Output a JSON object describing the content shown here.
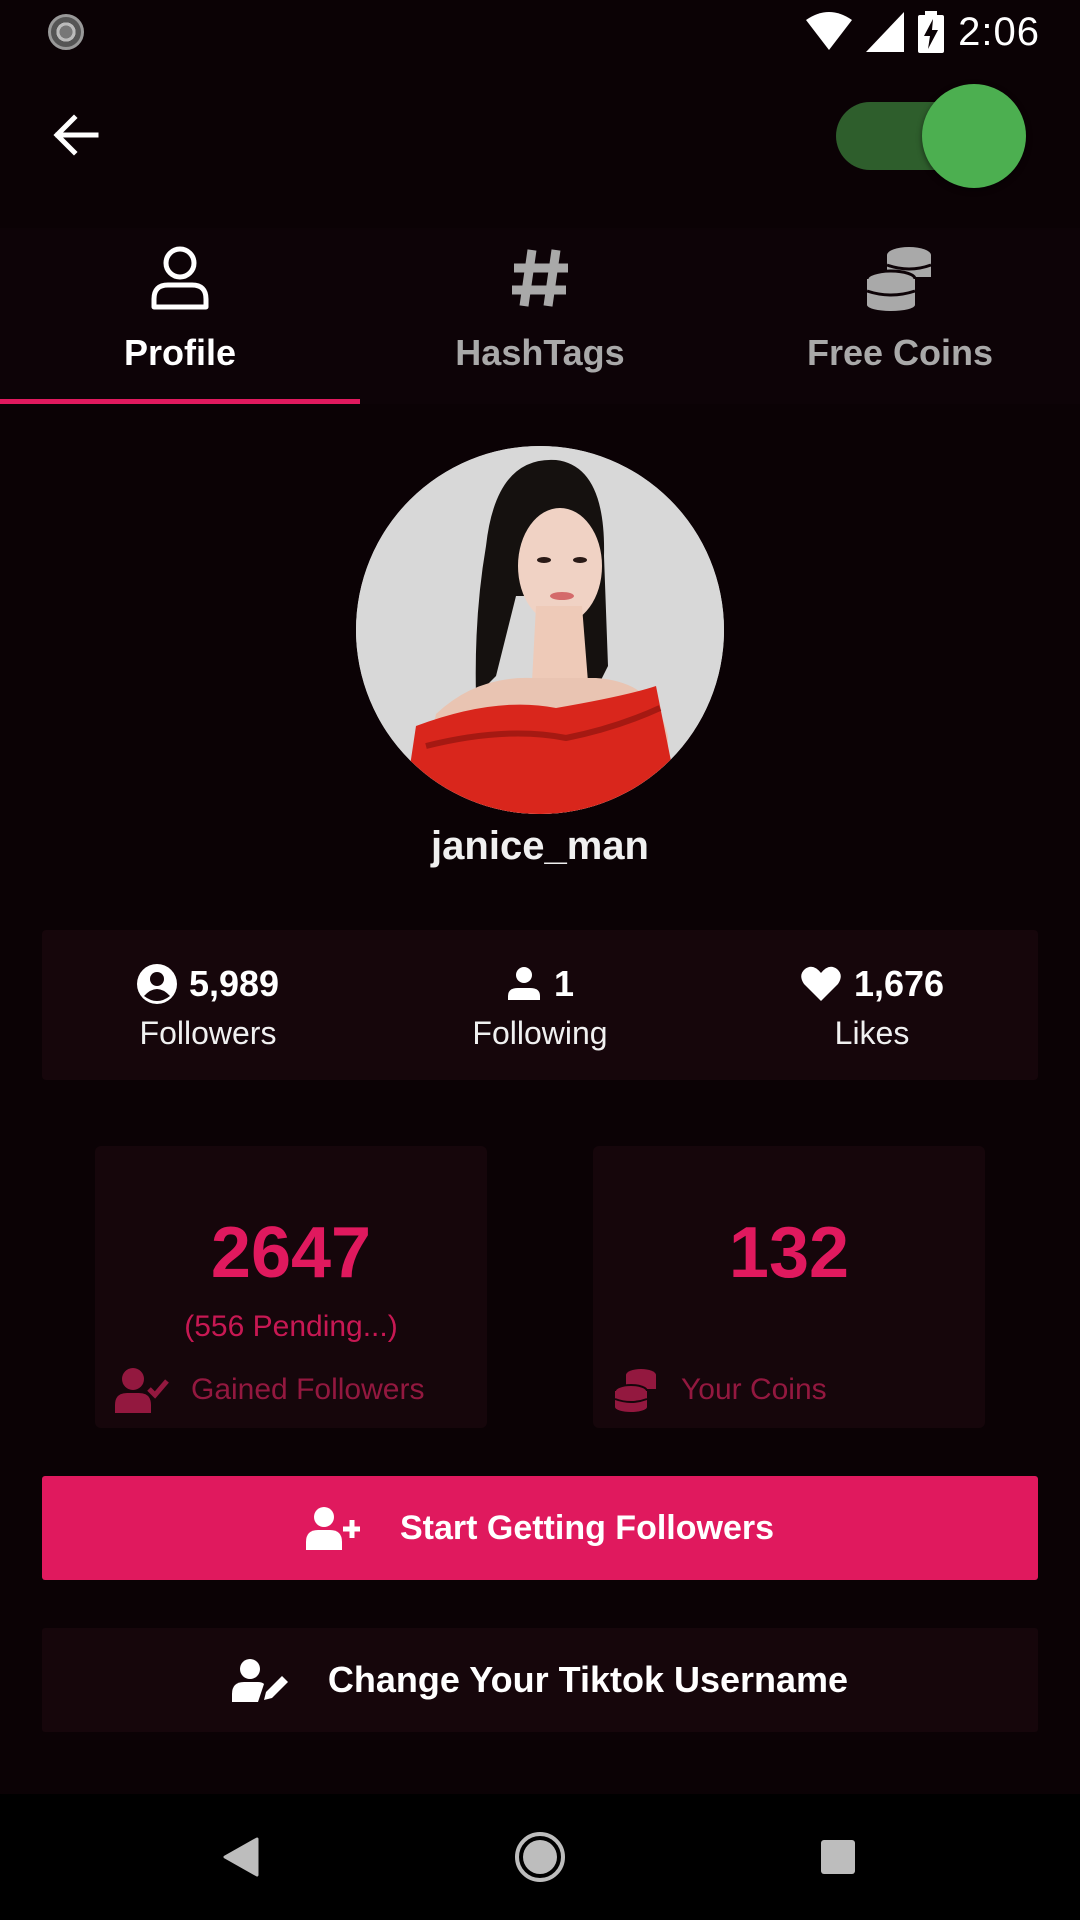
{
  "status_bar": {
    "time": "2:06"
  },
  "tabs": [
    {
      "label": "Profile",
      "icon": "person-outline-icon",
      "active": true
    },
    {
      "label": "HashTags",
      "icon": "hashtag-icon",
      "active": false
    },
    {
      "label": "Free Coins",
      "icon": "coins-icon",
      "active": false
    }
  ],
  "profile": {
    "username": "janice_man"
  },
  "stats": {
    "followers": {
      "value": "5,989",
      "label": "Followers"
    },
    "following": {
      "value": "1",
      "label": "Following"
    },
    "likes": {
      "value": "1,676",
      "label": "Likes"
    }
  },
  "cards": {
    "gained": {
      "value": "2647",
      "sub": "(556 Pending...)",
      "label": "Gained Followers"
    },
    "coins": {
      "value": "132",
      "label": "Your Coins"
    }
  },
  "buttons": {
    "start": "Start Getting Followers",
    "change_username": "Change Your Tiktok Username"
  },
  "colors": {
    "accent": "#e0195e",
    "toggle_on": "#4caf50",
    "background": "#0b0205",
    "panel": "#16060b"
  }
}
